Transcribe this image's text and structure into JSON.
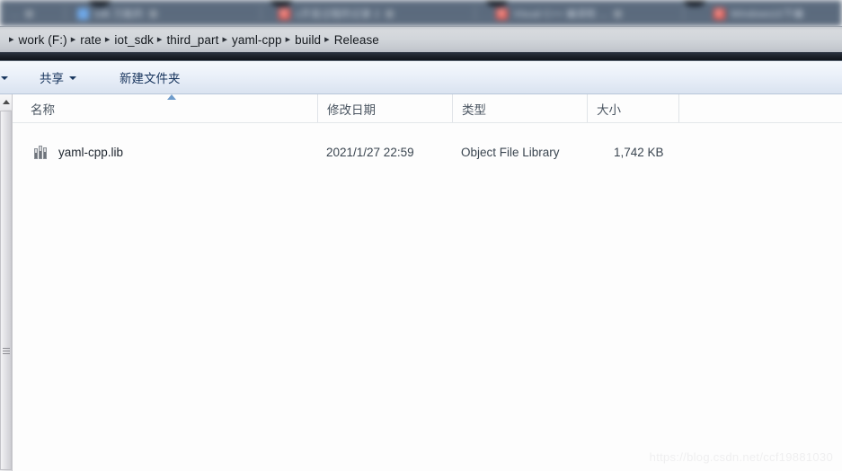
{
  "browser_tabs": {
    "tabs": [
      {
        "title": "sdk 万能的",
        "favicon": "blue-square-icon"
      },
      {
        "title": "c开发过程的记录 2",
        "favicon": "csdn-c-icon"
      },
      {
        "title": "Visual C++ 编译和 ...",
        "favicon": "csdn-c-icon"
      },
      {
        "title": "Windows10下编",
        "favicon": "csdn-c-icon"
      }
    ]
  },
  "address_bar": {
    "separator": "▸",
    "crumbs": [
      {
        "label": "work (F:)"
      },
      {
        "label": "rate"
      },
      {
        "label": "iot_sdk"
      },
      {
        "label": "third_part"
      },
      {
        "label": "yaml-cpp"
      },
      {
        "label": "build"
      },
      {
        "label": "Release"
      }
    ]
  },
  "toolbar": {
    "clipped_item_label": "",
    "share_label": "共享",
    "new_folder_label": "新建文件夹"
  },
  "file_list": {
    "columns": [
      {
        "label": "名称",
        "key": "name",
        "sorted": "asc"
      },
      {
        "label": "修改日期",
        "key": "modified"
      },
      {
        "label": "类型",
        "key": "type"
      },
      {
        "label": "大小",
        "key": "size"
      }
    ],
    "rows": [
      {
        "icon": "library-file-icon",
        "name": "yaml-cpp.lib",
        "modified": "2021/1/27 22:59",
        "type": "Object File Library",
        "size": "1,742 KB"
      }
    ]
  },
  "watermark": {
    "text": "https://blog.csdn.net/ccf19881030"
  },
  "colors": {
    "tabstrip_bg": "#5a6a7d",
    "addressbar_bg": "#d1d5da",
    "toolbar_bg": "#eaf0f9",
    "pane_bg": "#fdfdfd",
    "accent_blue": "#6f9ccb",
    "link_text": "#16335c",
    "csdn_red": "#e0554e"
  }
}
